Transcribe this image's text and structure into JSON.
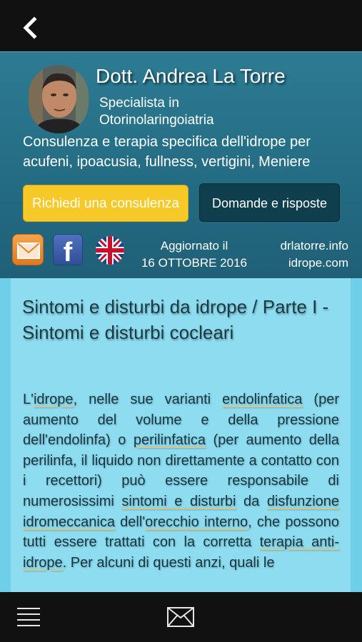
{
  "nav": {
    "back_icon": "chevron-left-icon"
  },
  "header": {
    "name": "Dott. Andrea La Torre",
    "specialty_line1": "Specialista in",
    "specialty_line2": "Otorinolaringoiatria",
    "description": "Consulenza e terapia specifica dell'idrope per acufeni, ipoacusia, fullness, vertigini, Meniere",
    "consult_button": "Richiedi una consulenza",
    "faq_button": "Domande e risposte",
    "updated_line1": "Aggiornato il",
    "updated_line2": "16 OTTOBRE 2016",
    "site1": "drlatorre.info",
    "site2": "idrope.com",
    "colors": {
      "header_bg": "#2d7b93",
      "consult_bg": "#f7c928",
      "faq_bg": "#0f3f4d"
    }
  },
  "article": {
    "title": "Sintomi e disturbi da idrope / Parte I - Sintomi e disturbi cocleari",
    "body": [
      {
        "t": "L'"
      },
      {
        "t": "idrope",
        "link": true
      },
      {
        "t": ", nelle sue varianti "
      },
      {
        "t": "endolinfatica",
        "link": true
      },
      {
        "t": " (per aumento del volume e della pressione dell'endolinfa) o "
      },
      {
        "t": "perilinfatica",
        "link": true
      },
      {
        "t": " (per aumento della perilinfa, il liquido non direttamente a contatto con i recettori) può essere responsabile di numerosissimi "
      },
      {
        "t": "sintomi e disturbi",
        "link": true
      },
      {
        "t": " da "
      },
      {
        "t": "disfunzione idromeccanica",
        "link": true
      },
      {
        "t": " dell'"
      },
      {
        "t": "orecchio interno",
        "link": true
      },
      {
        "t": ", che possono tutti essere trattati con la corretta "
      },
      {
        "t": "terapia anti-idrope",
        "link": true
      },
      {
        "t": ". Per alcuni di questi anzi, quali le"
      }
    ]
  },
  "bottom": {
    "menu_icon": "hamburger-menu-icon",
    "mail_icon": "envelope-icon"
  }
}
